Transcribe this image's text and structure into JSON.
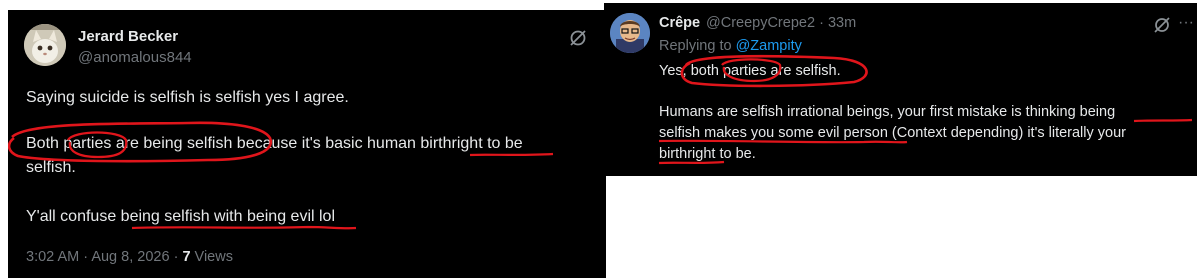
{
  "left_tweet": {
    "author_name": "Jerard Becker",
    "author_handle": "@anomalous844",
    "avatar": "cat-avatar",
    "icon": "grok-icon",
    "line1": "Saying suicide is selfish is selfish yes I agree.",
    "line2a": "Both parties are being selfish ",
    "line2b": "because it's basic human birthright to be",
    "line3": "selfish.",
    "line4": "Y'all confuse being selfish with being evil lol",
    "time": "3:02 AM",
    "sep": "·",
    "date": "Aug 8, 2026",
    "sep2": "·",
    "views_count": "7",
    "views_label": "Views"
  },
  "right_tweet": {
    "author_name": "Crêpe",
    "author_handle": "@CreepyCrepe2",
    "sep": "·",
    "age": "33m",
    "icon": "grok-icon",
    "more": "···",
    "replying_prefix": "Replying to ",
    "replying_handle": "@Zampity",
    "line1": "Yes, both parties are selfish.",
    "line2": "Humans are selfish irrational beings, your first mistake is thinking being",
    "line3": "selfish makes you some evil person (Context depending) it's literally your",
    "line4": "birthright to be."
  },
  "colors": {
    "background": "#000000",
    "text": "#e7e9ea",
    "secondary": "#71767b",
    "link": "#1d9bf0",
    "annotation": "#e0151b"
  }
}
